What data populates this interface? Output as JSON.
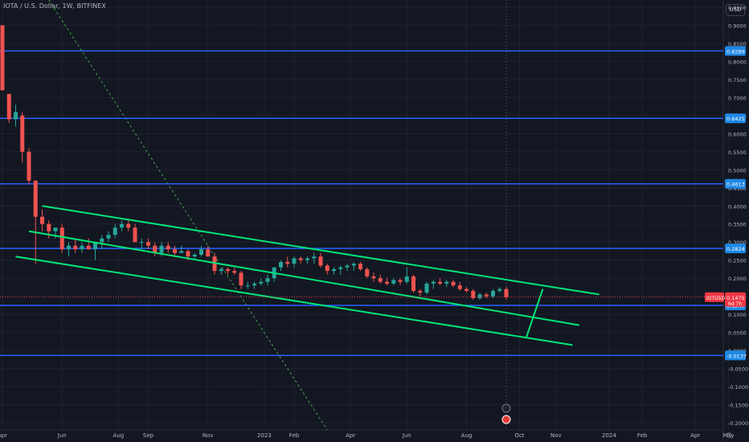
{
  "header": {
    "title": "IOTA / U.S. Dollar, 1W, BITFINEX",
    "currency": "USD"
  },
  "chart_data": {
    "type": "candlestick",
    "symbol": "IOTUSD",
    "timeframe": "1W",
    "exchange": "BITFINEX",
    "ylim": [
      -0.22,
      0.97
    ],
    "y_ticks": [
      0.95,
      0.9,
      0.85,
      0.8,
      0.75,
      0.7,
      0.65,
      0.6,
      0.55,
      0.5,
      0.45,
      0.4,
      0.35,
      0.3,
      0.25,
      0.2,
      0.15,
      0.1,
      0.05,
      0,
      -0.05,
      -0.1,
      -0.15,
      -0.2
    ],
    "x_ticks": [
      {
        "label": "Apr",
        "t": 0
      },
      {
        "label": "Jun",
        "t": 9
      },
      {
        "label": "Aug",
        "t": 17.5
      },
      {
        "label": "Sep",
        "t": 22
      },
      {
        "label": "Nov",
        "t": 31
      },
      {
        "label": "2023",
        "t": 39.5
      },
      {
        "label": "Feb",
        "t": 44
      },
      {
        "label": "Apr",
        "t": 52.5
      },
      {
        "label": "Jun",
        "t": 61
      },
      {
        "label": "Aug",
        "t": 70
      },
      {
        "label": "Oct",
        "t": 78
      },
      {
        "label": "Nov",
        "t": 83.5
      },
      {
        "label": "2024",
        "t": 91.5
      },
      {
        "label": "Feb",
        "t": 96.5
      },
      {
        "label": "Apr",
        "t": 104.5
      },
      {
        "label": "May",
        "t": 109.5
      }
    ],
    "horizontal_levels": [
      {
        "value": 0.8289,
        "label": "0.8289"
      },
      {
        "value": 0.6425,
        "label": "0.6425"
      },
      {
        "value": 0.4613,
        "label": "0.4613"
      },
      {
        "value": 0.2824,
        "label": "0.2824"
      },
      {
        "value": 0.1247,
        "label": "0.1247"
      },
      {
        "value": -0.0137,
        "label": "-0.0137"
      }
    ],
    "current_price": {
      "value": 0.1475,
      "label": "0.1475",
      "symbol": "IOTUSD",
      "countdown": "6d 7h"
    },
    "channel_lines": [
      {
        "t1": 6,
        "p1": 0.4,
        "t2": 90,
        "p2": 0.155
      },
      {
        "t1": 4,
        "p1": 0.33,
        "t2": 87,
        "p2": 0.07
      },
      {
        "t1": 2,
        "p1": 0.26,
        "t2": 86,
        "p2": 0.015
      }
    ],
    "vertical_marker": {
      "t1": 81.5,
      "p1": 0.17,
      "t2": 79,
      "p2": 0.035
    },
    "trend_line_dashed": {
      "t1": 7,
      "p1": 0.97,
      "t2": 49,
      "p2": -0.22
    },
    "event_column_t": 76,
    "candles": [
      {
        "o": 0.9,
        "h": 0.9,
        "l": 0.72,
        "c": 0.72
      },
      {
        "o": 0.71,
        "h": 0.71,
        "l": 0.63,
        "c": 0.64
      },
      {
        "o": 0.64,
        "h": 0.68,
        "l": 0.62,
        "c": 0.66
      },
      {
        "o": 0.65,
        "h": 0.66,
        "l": 0.52,
        "c": 0.55
      },
      {
        "o": 0.55,
        "h": 0.56,
        "l": 0.46,
        "c": 0.47
      },
      {
        "o": 0.47,
        "h": 0.47,
        "l": 0.24,
        "c": 0.37
      },
      {
        "o": 0.37,
        "h": 0.39,
        "l": 0.33,
        "c": 0.35
      },
      {
        "o": 0.35,
        "h": 0.36,
        "l": 0.31,
        "c": 0.33
      },
      {
        "o": 0.33,
        "h": 0.34,
        "l": 0.31,
        "c": 0.34
      },
      {
        "o": 0.34,
        "h": 0.35,
        "l": 0.27,
        "c": 0.28
      },
      {
        "o": 0.28,
        "h": 0.3,
        "l": 0.26,
        "c": 0.29
      },
      {
        "o": 0.29,
        "h": 0.31,
        "l": 0.27,
        "c": 0.28
      },
      {
        "o": 0.28,
        "h": 0.3,
        "l": 0.27,
        "c": 0.29
      },
      {
        "o": 0.29,
        "h": 0.31,
        "l": 0.28,
        "c": 0.28
      },
      {
        "o": 0.28,
        "h": 0.3,
        "l": 0.25,
        "c": 0.3
      },
      {
        "o": 0.3,
        "h": 0.32,
        "l": 0.28,
        "c": 0.31
      },
      {
        "o": 0.31,
        "h": 0.33,
        "l": 0.3,
        "c": 0.32
      },
      {
        "o": 0.32,
        "h": 0.35,
        "l": 0.31,
        "c": 0.34
      },
      {
        "o": 0.34,
        "h": 0.36,
        "l": 0.33,
        "c": 0.35
      },
      {
        "o": 0.35,
        "h": 0.36,
        "l": 0.33,
        "c": 0.34
      },
      {
        "o": 0.34,
        "h": 0.35,
        "l": 0.3,
        "c": 0.3
      },
      {
        "o": 0.3,
        "h": 0.31,
        "l": 0.28,
        "c": 0.3
      },
      {
        "o": 0.3,
        "h": 0.31,
        "l": 0.28,
        "c": 0.29
      },
      {
        "o": 0.29,
        "h": 0.3,
        "l": 0.26,
        "c": 0.27
      },
      {
        "o": 0.27,
        "h": 0.3,
        "l": 0.26,
        "c": 0.29
      },
      {
        "o": 0.29,
        "h": 0.3,
        "l": 0.27,
        "c": 0.28
      },
      {
        "o": 0.28,
        "h": 0.29,
        "l": 0.26,
        "c": 0.27
      },
      {
        "o": 0.27,
        "h": 0.29,
        "l": 0.27,
        "c": 0.275
      },
      {
        "o": 0.275,
        "h": 0.28,
        "l": 0.25,
        "c": 0.26
      },
      {
        "o": 0.26,
        "h": 0.27,
        "l": 0.25,
        "c": 0.265
      },
      {
        "o": 0.265,
        "h": 0.29,
        "l": 0.26,
        "c": 0.28
      },
      {
        "o": 0.28,
        "h": 0.29,
        "l": 0.26,
        "c": 0.26
      },
      {
        "o": 0.26,
        "h": 0.27,
        "l": 0.21,
        "c": 0.22
      },
      {
        "o": 0.22,
        "h": 0.23,
        "l": 0.21,
        "c": 0.225
      },
      {
        "o": 0.225,
        "h": 0.23,
        "l": 0.21,
        "c": 0.22
      },
      {
        "o": 0.22,
        "h": 0.23,
        "l": 0.21,
        "c": 0.215
      },
      {
        "o": 0.215,
        "h": 0.22,
        "l": 0.17,
        "c": 0.18
      },
      {
        "o": 0.18,
        "h": 0.19,
        "l": 0.17,
        "c": 0.18
      },
      {
        "o": 0.18,
        "h": 0.19,
        "l": 0.17,
        "c": 0.185
      },
      {
        "o": 0.185,
        "h": 0.2,
        "l": 0.18,
        "c": 0.19
      },
      {
        "o": 0.19,
        "h": 0.21,
        "l": 0.18,
        "c": 0.2
      },
      {
        "o": 0.2,
        "h": 0.23,
        "l": 0.19,
        "c": 0.23
      },
      {
        "o": 0.23,
        "h": 0.25,
        "l": 0.22,
        "c": 0.245
      },
      {
        "o": 0.245,
        "h": 0.26,
        "l": 0.23,
        "c": 0.24
      },
      {
        "o": 0.24,
        "h": 0.26,
        "l": 0.23,
        "c": 0.255
      },
      {
        "o": 0.255,
        "h": 0.26,
        "l": 0.24,
        "c": 0.25
      },
      {
        "o": 0.25,
        "h": 0.26,
        "l": 0.24,
        "c": 0.255
      },
      {
        "o": 0.255,
        "h": 0.27,
        "l": 0.24,
        "c": 0.26
      },
      {
        "o": 0.26,
        "h": 0.27,
        "l": 0.23,
        "c": 0.235
      },
      {
        "o": 0.235,
        "h": 0.24,
        "l": 0.21,
        "c": 0.22
      },
      {
        "o": 0.22,
        "h": 0.23,
        "l": 0.21,
        "c": 0.225
      },
      {
        "o": 0.225,
        "h": 0.235,
        "l": 0.21,
        "c": 0.23
      },
      {
        "o": 0.23,
        "h": 0.24,
        "l": 0.22,
        "c": 0.235
      },
      {
        "o": 0.235,
        "h": 0.245,
        "l": 0.22,
        "c": 0.24
      },
      {
        "o": 0.24,
        "h": 0.245,
        "l": 0.22,
        "c": 0.225
      },
      {
        "o": 0.225,
        "h": 0.23,
        "l": 0.2,
        "c": 0.205
      },
      {
        "o": 0.205,
        "h": 0.215,
        "l": 0.19,
        "c": 0.2
      },
      {
        "o": 0.2,
        "h": 0.21,
        "l": 0.185,
        "c": 0.19
      },
      {
        "o": 0.19,
        "h": 0.2,
        "l": 0.18,
        "c": 0.185
      },
      {
        "o": 0.185,
        "h": 0.2,
        "l": 0.18,
        "c": 0.195
      },
      {
        "o": 0.195,
        "h": 0.2,
        "l": 0.18,
        "c": 0.19
      },
      {
        "o": 0.19,
        "h": 0.23,
        "l": 0.185,
        "c": 0.205
      },
      {
        "o": 0.205,
        "h": 0.21,
        "l": 0.16,
        "c": 0.165
      },
      {
        "o": 0.165,
        "h": 0.17,
        "l": 0.15,
        "c": 0.16
      },
      {
        "o": 0.16,
        "h": 0.19,
        "l": 0.155,
        "c": 0.185
      },
      {
        "o": 0.185,
        "h": 0.195,
        "l": 0.17,
        "c": 0.19
      },
      {
        "o": 0.19,
        "h": 0.2,
        "l": 0.18,
        "c": 0.185
      },
      {
        "o": 0.185,
        "h": 0.195,
        "l": 0.175,
        "c": 0.19
      },
      {
        "o": 0.19,
        "h": 0.195,
        "l": 0.175,
        "c": 0.18
      },
      {
        "o": 0.18,
        "h": 0.19,
        "l": 0.165,
        "c": 0.17
      },
      {
        "o": 0.17,
        "h": 0.175,
        "l": 0.16,
        "c": 0.165
      },
      {
        "o": 0.165,
        "h": 0.17,
        "l": 0.14,
        "c": 0.145
      },
      {
        "o": 0.145,
        "h": 0.16,
        "l": 0.14,
        "c": 0.155
      },
      {
        "o": 0.155,
        "h": 0.16,
        "l": 0.145,
        "c": 0.15
      },
      {
        "o": 0.15,
        "h": 0.17,
        "l": 0.145,
        "c": 0.165
      },
      {
        "o": 0.165,
        "h": 0.175,
        "l": 0.16,
        "c": 0.17
      },
      {
        "o": 0.17,
        "h": 0.175,
        "l": 0.14,
        "c": 0.1475
      }
    ]
  },
  "colors": {
    "background": "#131722",
    "grid": "#1e222d",
    "axis_text": "#b2b5be",
    "up": "#26a69a",
    "down": "#ef5350",
    "level": "#2962ff",
    "level_label": "#1e88e5",
    "channel": "#00e676",
    "trend_dashed": "#43a047",
    "price_label": "#f23645"
  }
}
